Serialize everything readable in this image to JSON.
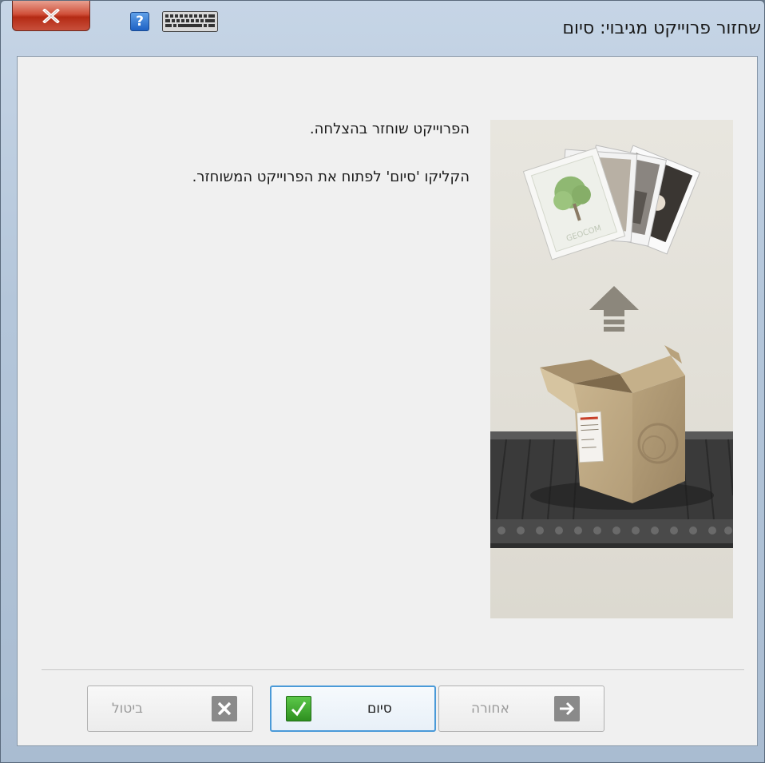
{
  "window": {
    "title": "שחזור פרוייקט מגיבוי: סיום"
  },
  "titlebar": {
    "close_icon": "close-icon",
    "help_label": "?",
    "help_icon": "help-icon",
    "keyboard_icon": "keyboard-icon"
  },
  "main": {
    "message_success": "הפרוייקט שוחזר בהצלחה.",
    "message_instruction": "הקליקו 'סיום' לפתוח את הפרוייקט המשוחזר.",
    "illustration": "restore-illustration",
    "illustration_logo_text": "GEOCOM"
  },
  "buttons": {
    "cancel_label": "ביטול",
    "finish_label": "סיום",
    "back_label": "אחורה"
  },
  "colors": {
    "close_red": "#c8402a",
    "help_blue": "#1e62c4",
    "finish_green": "#3aa82c",
    "focus_blue": "#4a9ad8"
  }
}
